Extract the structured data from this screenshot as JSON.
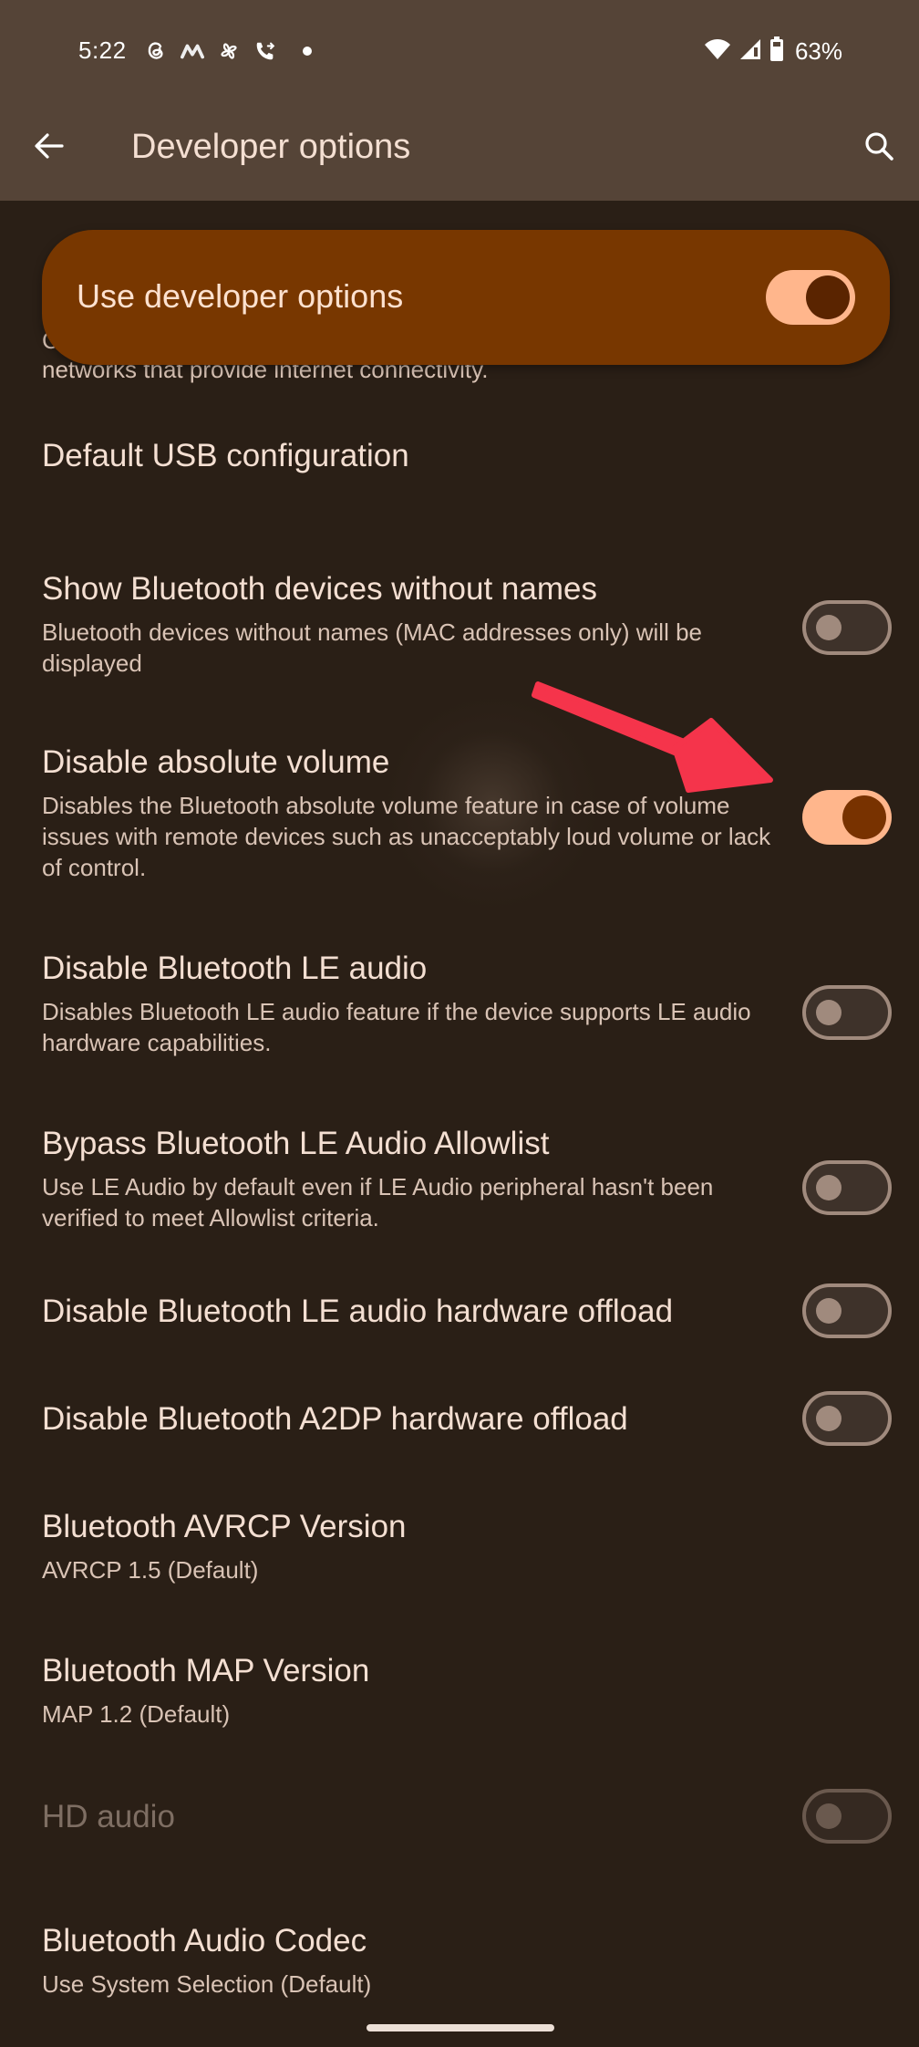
{
  "status_bar": {
    "time": "5:22",
    "left_icons": [
      "threads-icon",
      "m-app-icon",
      "pinwheel-icon",
      "call-forward-icon",
      "notification-dot"
    ],
    "right_icons": [
      "wifi-icon",
      "cellular-signal-icon",
      "battery-icon"
    ],
    "battery_percent": "63%"
  },
  "app_bar": {
    "back_icon": "arrow-back-icon",
    "title": "Developer options",
    "search_icon": "search-icon"
  },
  "master_switch": {
    "label": "Use developer options",
    "checked": true
  },
  "partially_hidden_text": {
    "first_char": "C",
    "second_line": "networks that provide internet connectivity."
  },
  "settings": [
    {
      "title": "Default USB configuration",
      "subtitle": null,
      "toggle": null
    },
    {
      "title": "Show Bluetooth devices without names",
      "subtitle": "Bluetooth devices without names (MAC addresses only) will be displayed",
      "toggle": false
    },
    {
      "title": "Disable absolute volume",
      "subtitle": "Disables the Bluetooth absolute volume feature in case of volume issues with remote devices such as unacceptably loud volume or lack of control.",
      "toggle": true
    },
    {
      "title": "Disable Bluetooth LE audio",
      "subtitle": "Disables Bluetooth LE audio feature if the device supports LE audio hardware capabilities.",
      "toggle": false
    },
    {
      "title": "Bypass Bluetooth LE Audio Allowlist",
      "subtitle": "Use LE Audio by default even if LE Audio peripheral hasn't been verified to meet Allowlist criteria.",
      "toggle": false
    },
    {
      "title": "Disable Bluetooth LE audio hardware offload",
      "subtitle": null,
      "toggle": false
    },
    {
      "title": "Disable Bluetooth A2DP hardware offload",
      "subtitle": null,
      "toggle": false
    },
    {
      "title": "Bluetooth AVRCP Version",
      "subtitle": "AVRCP 1.5 (Default)",
      "toggle": null
    },
    {
      "title": "Bluetooth MAP Version",
      "subtitle": "MAP 1.2 (Default)",
      "toggle": null
    },
    {
      "title": "HD audio",
      "subtitle": null,
      "toggle": false,
      "disabled": true
    },
    {
      "title": "Bluetooth Audio Codec",
      "subtitle": "Use System Selection (Default)",
      "toggle": null
    }
  ],
  "annotation": {
    "type": "red-arrow",
    "points_to": "Disable absolute volume toggle",
    "color": "#f5344b"
  },
  "colors": {
    "background": "#2a1f16",
    "app_bar": "#554437",
    "card": "#783700",
    "toggle_on_track": "#ffb68c",
    "toggle_on_knob": "#783200",
    "toggle_off_border": "#a08a7d",
    "title_text": "#f4dfd2",
    "subtitle_text": "#d9c3b5"
  }
}
